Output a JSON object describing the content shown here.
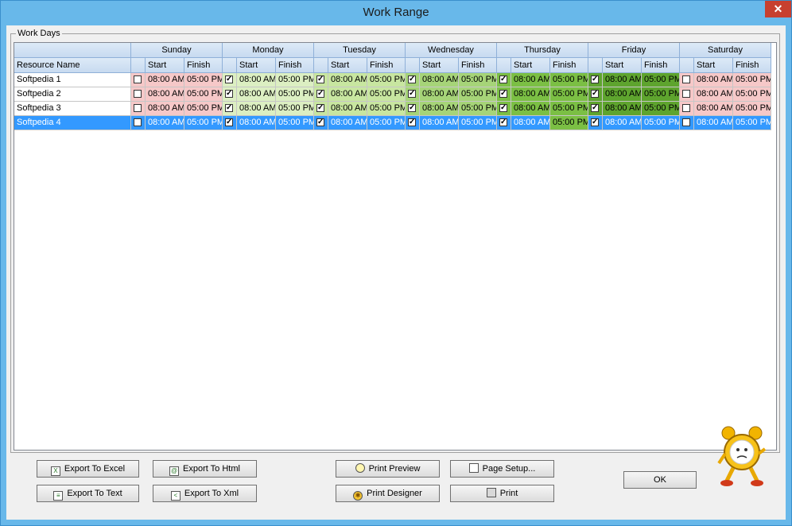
{
  "window": {
    "title": "Work Range",
    "close_glyph": "✕"
  },
  "group": {
    "title": "Work Days"
  },
  "grid": {
    "resource_header": "Resource Name",
    "start_label": "Start",
    "finish_label": "Finish",
    "days": [
      {
        "name": "Sunday",
        "color": "#f6c8c8"
      },
      {
        "name": "Monday",
        "color": "#dcefc2"
      },
      {
        "name": "Tuesday",
        "color": "#c8e6a0"
      },
      {
        "name": "Wednesday",
        "color": "#a6d478"
      },
      {
        "name": "Thursday",
        "color": "#7bbf44"
      },
      {
        "name": "Friday",
        "color": "#5ea42e"
      },
      {
        "name": "Saturday",
        "color": "#f6c8c8"
      }
    ],
    "rows": [
      {
        "name": "Softpedia 1",
        "selected": false,
        "checked": [
          false,
          true,
          true,
          true,
          true,
          true,
          false
        ],
        "start": "08:00 AM",
        "finish": "05:00 PM"
      },
      {
        "name": "Softpedia 2",
        "selected": false,
        "checked": [
          false,
          true,
          true,
          true,
          true,
          true,
          false
        ],
        "start": "08:00 AM",
        "finish": "05:00 PM"
      },
      {
        "name": "Softpedia 3",
        "selected": false,
        "checked": [
          false,
          true,
          true,
          true,
          true,
          true,
          false
        ],
        "start": "08:00 AM",
        "finish": "05:00 PM"
      },
      {
        "name": "Softpedia 4",
        "selected": true,
        "checked": [
          false,
          true,
          true,
          true,
          true,
          true,
          false
        ],
        "start": "08:00 AM",
        "finish": "05:00 PM"
      }
    ],
    "selection_color": "#3399ff",
    "selected_focus_color": "#7bbf44"
  },
  "buttons": {
    "export_excel": "Export To Excel",
    "export_html": "Export To Html",
    "export_text": "Export To Text",
    "export_xml": "Export To Xml",
    "print_preview": "Print Preview",
    "page_setup": "Page Setup...",
    "print_designer": "Print Designer",
    "print": "Print",
    "ok": "OK"
  }
}
